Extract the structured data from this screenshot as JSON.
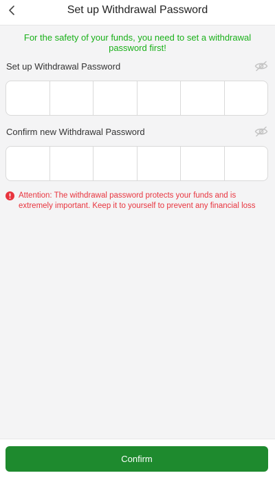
{
  "header": {
    "title": "Set up Withdrawal Password",
    "back_icon": "chevron-left-icon"
  },
  "notice": "For the safety of your funds, you need to set a withdrawal password first!",
  "password_section": {
    "label": "Set up Withdrawal Password",
    "toggle_icon": "eye-off-icon",
    "digits": [
      "",
      "",
      "",
      "",
      "",
      ""
    ]
  },
  "confirm_section": {
    "label": "Confirm new Withdrawal Password",
    "toggle_icon": "eye-off-icon",
    "digits": [
      "",
      "",
      "",
      "",
      "",
      ""
    ]
  },
  "attention": {
    "icon": "exclamation-circle-icon",
    "text": "Attention: The withdrawal password protects your funds and is extremely important. Keep it to yourself to prevent any financial loss"
  },
  "footer": {
    "confirm_label": "Confirm"
  },
  "colors": {
    "notice": "#19b019",
    "attention": "#e8343e",
    "button": "#1e8a2e",
    "background": "#f4f4f5"
  }
}
